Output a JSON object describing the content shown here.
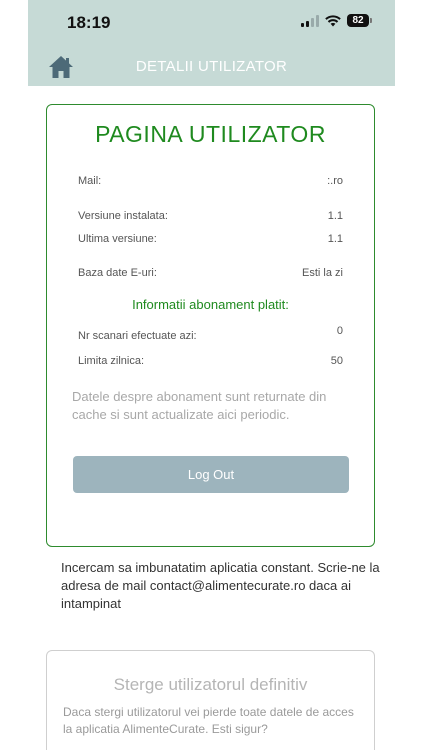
{
  "status": {
    "time": "18:19",
    "battery": "82"
  },
  "nav": {
    "title": "DETALII UTILIZATOR",
    "home_icon": "home-icon"
  },
  "user_card": {
    "title": "PAGINA UTILIZATOR",
    "mail_label": "Mail:",
    "mail_value": ":.ro",
    "installed_label": "Versiune instalata:",
    "installed_value": "1.1",
    "latest_label": "Ultima versiune:",
    "latest_value": "1.1",
    "db_label": "Baza date E-uri:",
    "db_value": "Esti la zi",
    "subscription_title": "Informatii abonament platit:",
    "scans_label": "Nr scanari efectuate azi:",
    "scans_value": "0",
    "limit_label": "Limita zilnica:",
    "limit_value": "50",
    "cache_note": "Datele despre abonament sunt returnate din cache si sunt actualizate aici periodic.",
    "logout_label": "Log Out"
  },
  "info_text": "Incercam sa imbunatatim aplicatia constant. Scrie-ne la adresa de mail contact@alimentecurate.ro daca ai intampinat",
  "delete_card": {
    "title": "Sterge utilizatorul definitiv",
    "text": "Daca stergi utilizatorul vei pierde toate datele de acces la aplicatia AlimenteCurate. Esti sigur?"
  },
  "colors": {
    "header_bg": "#c6dad6",
    "accent_green": "#1f8a1f",
    "logout_bg": "#9db4bd"
  }
}
